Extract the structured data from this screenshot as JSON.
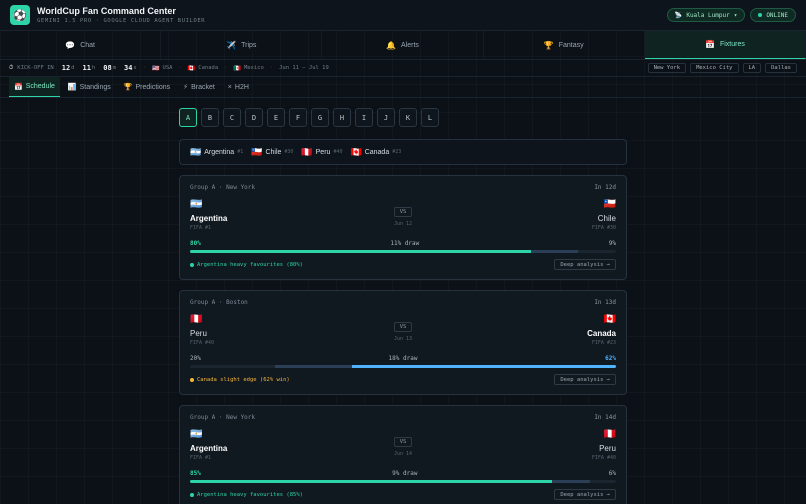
{
  "app": {
    "title": "WorldCup Fan Command Center",
    "subtitle": "GEMINI 1.5 PRO · GOOGLE CLOUD AGENT BUILDER",
    "logo_icon": "⚽",
    "location": "Kuala Lumpur",
    "location_icon": "📡",
    "status": "ONLINE"
  },
  "nav": [
    {
      "label": "Chat",
      "icon": "💬"
    },
    {
      "label": "Trips",
      "icon": "✈️"
    },
    {
      "label": "Alerts",
      "icon": "🔔"
    },
    {
      "label": "Fantasy",
      "icon": "🏆"
    },
    {
      "label": "Fixtures",
      "icon": "📅"
    }
  ],
  "kickoff": {
    "label": "KICK-OFF IN",
    "icon": "⏱",
    "days": "12",
    "days_unit": "d",
    "hours": "11",
    "hours_unit": "h",
    "minutes": "08",
    "minutes_unit": "m",
    "seconds": "34",
    "seconds_unit": "s",
    "hosts": [
      {
        "flag": "🇺🇸",
        "name": "USA"
      },
      {
        "flag": "🇨🇦",
        "name": "Canada"
      },
      {
        "flag": "🇲🇽",
        "name": "Mexico"
      }
    ],
    "dates": "Jun 11 – Jul 19",
    "cities": [
      "New York",
      "Mexico City",
      "LA",
      "Dallas"
    ]
  },
  "subtabs": [
    {
      "label": "Schedule",
      "icon": "📅"
    },
    {
      "label": "Standings",
      "icon": "📊"
    },
    {
      "label": "Predictions",
      "icon": "🏆"
    },
    {
      "label": "Bracket",
      "icon": "⚡"
    },
    {
      "label": "H2H",
      "icon": "×"
    }
  ],
  "groups": [
    "A",
    "B",
    "C",
    "D",
    "E",
    "F",
    "G",
    "H",
    "I",
    "J",
    "K",
    "L"
  ],
  "group_teams": [
    {
      "flag": "🇦🇷",
      "name": "Argentina",
      "rank": "#1"
    },
    {
      "flag": "🇨🇱",
      "name": "Chile",
      "rank": "#30"
    },
    {
      "flag": "🇵🇪",
      "name": "Peru",
      "rank": "#40"
    },
    {
      "flag": "🇨🇦",
      "name": "Canada",
      "rank": "#23"
    }
  ],
  "matches": [
    {
      "header": "Group A · New York",
      "countdown": "In 12d",
      "home": {
        "flag": "🇦🇷",
        "name": "Argentina",
        "rank": "FIFA #1"
      },
      "away": {
        "flag": "🇨🇱",
        "name": "Chile",
        "rank": "FIFA #30"
      },
      "vs": "VS",
      "date": "Jun 12",
      "home_pct": "80%",
      "draw": "11% draw",
      "away_pct": "9%",
      "home_val": 80,
      "draw_val": 11,
      "away_val": 9,
      "insight": "Argentina heavy favourites (80%)",
      "button": "Deep analysis →"
    },
    {
      "header": "Group A · Boston",
      "countdown": "In 13d",
      "home": {
        "flag": "🇵🇪",
        "name": "Peru",
        "rank": "FIFA #40"
      },
      "away": {
        "flag": "🇨🇦",
        "name": "Canada",
        "rank": "FIFA #23"
      },
      "vs": "VS",
      "date": "Jun 13",
      "home_pct": "20%",
      "draw": "18% draw",
      "away_pct": "62%",
      "home_val": 20,
      "draw_val": 18,
      "away_val": 62,
      "insight": "Canada slight edge (62% win)",
      "button": "Deep analysis →"
    },
    {
      "header": "Group A · New York",
      "countdown": "In 14d",
      "home": {
        "flag": "🇦🇷",
        "name": "Argentina",
        "rank": "FIFA #1"
      },
      "away": {
        "flag": "🇵🇪",
        "name": "Peru",
        "rank": "FIFA #40"
      },
      "vs": "VS",
      "date": "Jun 14",
      "home_pct": "85%",
      "draw": "9% draw",
      "away_pct": "6%",
      "home_val": 85,
      "draw_val": 9,
      "away_val": 6,
      "insight": "Argentina heavy favourites (85%)",
      "button": "Deep analysis →"
    }
  ]
}
